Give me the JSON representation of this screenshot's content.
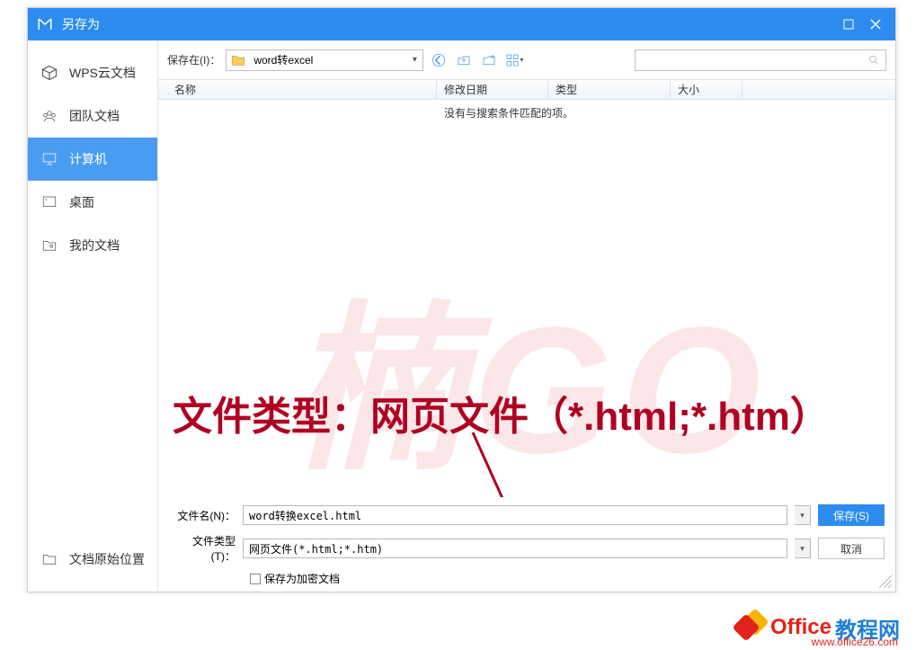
{
  "window": {
    "title": "另存为"
  },
  "sidebar": {
    "items": [
      {
        "label": "WPS云文档"
      },
      {
        "label": "团队文档"
      },
      {
        "label": "计算机"
      },
      {
        "label": "桌面"
      },
      {
        "label": "我的文档"
      }
    ],
    "bottom": {
      "label": "文档原始位置"
    }
  },
  "toolbar": {
    "location_label": "保存在(I)：",
    "location_value": "word转excel"
  },
  "columns": {
    "name": "名称",
    "date": "修改日期",
    "type": "类型",
    "size": "大小"
  },
  "filelist": {
    "empty": "没有与搜索条件匹配的项。"
  },
  "watermark": "楠GO",
  "annotation": "文件类型：网页文件（*.html;*.htm）",
  "form": {
    "filename_label": "文件名(N)：",
    "filename_value": "word转换excel.html",
    "filetype_label": "文件类型(T)：",
    "filetype_value": "网页文件(*.html;*.htm)",
    "encrypt_label": "保存为加密文档",
    "save_btn": "保存(S)",
    "cancel_btn": "取消"
  },
  "site": {
    "t1": "Office",
    "t2": "教程网",
    "url": "www.office26.com"
  }
}
